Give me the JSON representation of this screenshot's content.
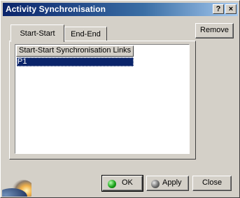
{
  "window": {
    "title": "Activity Synchronisation",
    "help_label": "?",
    "close_label": "×"
  },
  "tabs": [
    {
      "label": "Start-Start",
      "active": true
    },
    {
      "label": "End-End",
      "active": false
    }
  ],
  "list": {
    "column_header": "Start-Start Synchronisation Links",
    "rows": [
      {
        "label": "P1",
        "selected": true
      }
    ]
  },
  "buttons": {
    "remove": "Remove",
    "ok": "OK",
    "apply": "Apply",
    "close": "Close"
  },
  "icons": {
    "ok": "green-ball-icon",
    "apply": "gray-ball-icon",
    "logo": "catia-globe-logo"
  },
  "colors": {
    "title_gradient_start": "#0a246a",
    "title_gradient_end": "#a6caf0",
    "selection": "#0a246a",
    "face": "#d4d0c8",
    "ok_dot": "#19a219"
  }
}
